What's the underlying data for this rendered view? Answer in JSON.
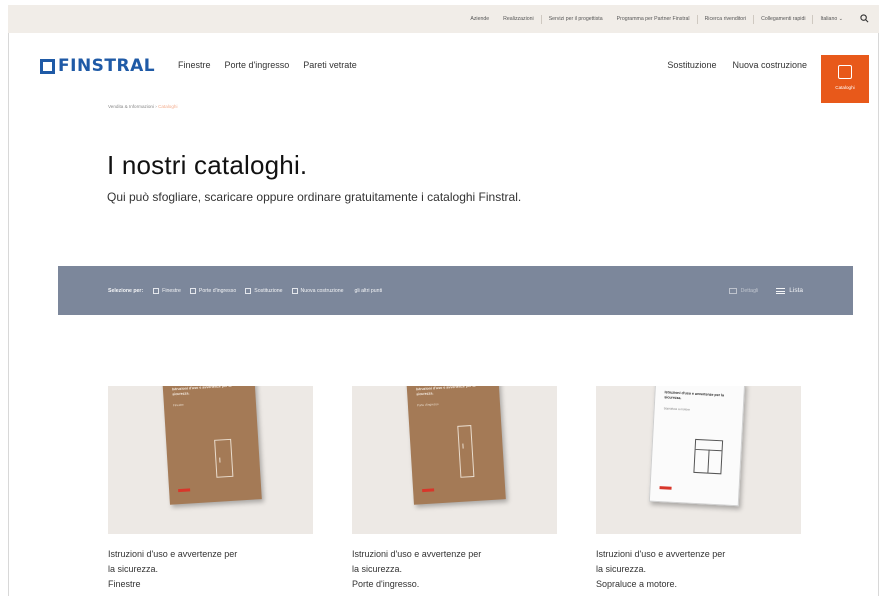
{
  "utility_bar": {
    "links": [
      "Aziende",
      "Realizzazioni",
      "Servizi per il progettista",
      "Programma per Partner Finstral",
      "Ricerca rivenditori",
      "Collegamenti rapidi",
      "Italiano ⌄"
    ],
    "search_icon": "search-icon"
  },
  "header": {
    "logo_text": "FINSTRAL",
    "brand_color": "#1f5aa6",
    "accent_color": "#e8591a",
    "main_nav": [
      "Finestre",
      "Porte d'ingresso",
      "Pareti vetrate"
    ],
    "right_nav": [
      "Sostituzione",
      "Nuova costruzione"
    ],
    "cta_label": "Cataloghi"
  },
  "breadcrumb": {
    "path": "Vendita & Informazioni ›",
    "current": "Cataloghi"
  },
  "page": {
    "title": "I nostri cataloghi.",
    "intro": "Qui può sfogliare, scaricare oppure ordinare gratuitamente i cataloghi Finstral."
  },
  "filter_bar": {
    "label": "Selezione per:",
    "options": [
      "Finestre",
      "Porte d'ingresso",
      "Sostituzione",
      "Nuova costruzione"
    ],
    "more": "gli altri punti",
    "views": [
      {
        "label": "Dettagli",
        "active": false
      },
      {
        "label": "Lista",
        "active": true
      }
    ],
    "background_color": "#7c879b"
  },
  "catalogs": [
    {
      "cover_title": "Istruzioni d'uso e avvertenze per la sicurezza.",
      "cover_subtitle": "Finestre",
      "cover_style": "kraft",
      "lines": [
        "Istruzioni d'uso e avvertenze per",
        "la sicurezza.",
        "Finestre"
      ]
    },
    {
      "cover_title": "Istruzioni d'uso e avvertenze per la sicurezza.",
      "cover_subtitle": "Porte d'ingresso",
      "cover_style": "kraft",
      "lines": [
        "Istruzioni d'uso e avvertenze per",
        "la sicurezza.",
        "Porte d'ingresso."
      ]
    },
    {
      "cover_title": "Istruzioni d'uso e avvertenze per la sicurezza.",
      "cover_subtitle": "Sopraluce a motore",
      "cover_style": "white",
      "lines": [
        "Istruzioni d'uso e avvertenze per",
        "la sicurezza.",
        "Sopraluce a motore."
      ]
    }
  ]
}
